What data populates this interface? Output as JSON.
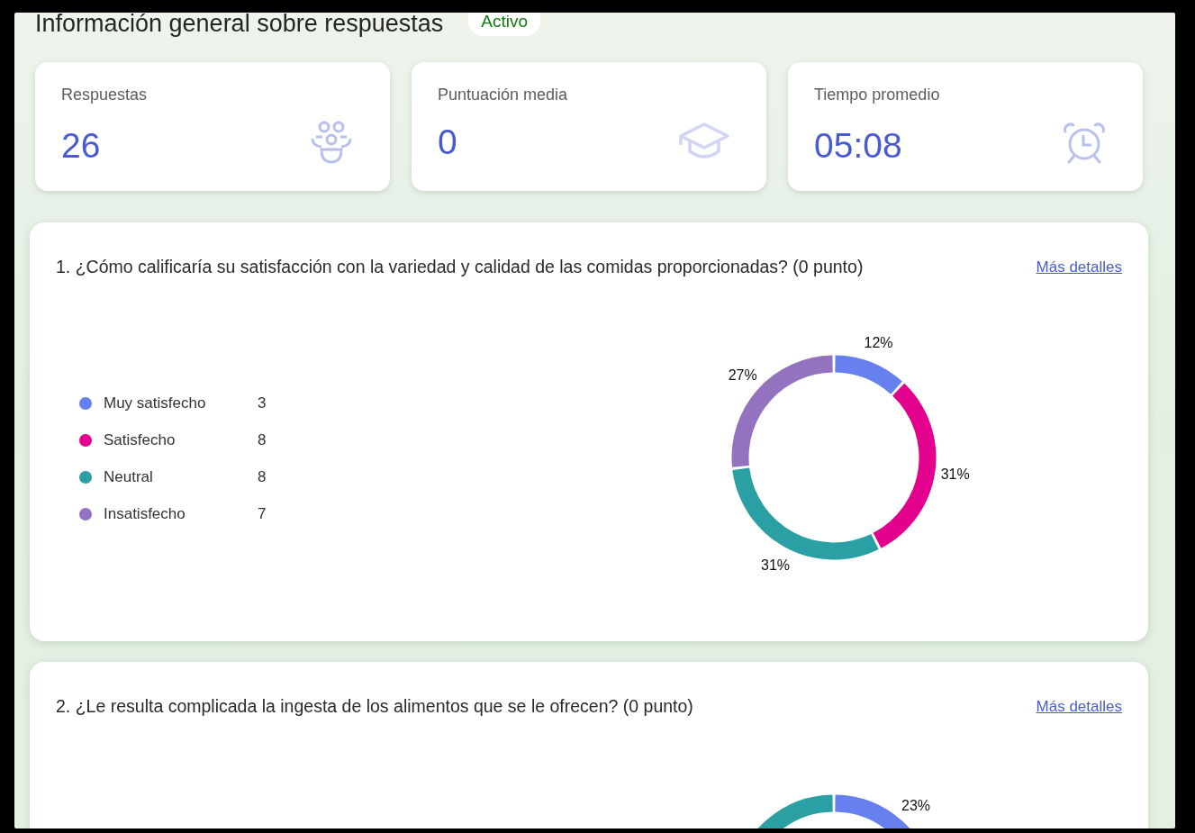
{
  "header": {
    "title": "Información general sobre respuestas",
    "status": "Activo"
  },
  "stats": [
    {
      "kind": "people",
      "label": "Respuestas",
      "value": "26"
    },
    {
      "kind": "cap",
      "label": "Puntuación media",
      "value": "0"
    },
    {
      "kind": "clock",
      "label": "Tiempo promedio",
      "value": "05:08"
    }
  ],
  "questions": [
    {
      "text": "1. ¿Cómo calificaría su satisfacción con la variedad y calidad de las comidas proporcionadas?  (0 punto)",
      "link": "Más detalles",
      "legend": [
        {
          "count": "3",
          "color": "#6680f0"
        },
        {
          "count": "8",
          "color": "#e3008c"
        },
        {
          "count": "8",
          "color": "#2aa0a4"
        },
        {
          "count": "7",
          "color": "#9373c0"
        }
      ],
      "chart_data": {
        "type": "donut",
        "categories": [
          "Muy satisfecho",
          "Satisfecho",
          "Neutral",
          "Insatisfecho"
        ],
        "values": [
          12,
          31,
          31,
          27
        ],
        "value_labels": [
          "12%",
          "31%",
          "31%",
          "27%"
        ]
      }
    },
    {
      "text": "2. ¿Le resulta complicada la ingesta de los alimentos que se le ofrecen? (0 punto)",
      "link": "Más detalles",
      "partial_label": "23%"
    }
  ]
}
